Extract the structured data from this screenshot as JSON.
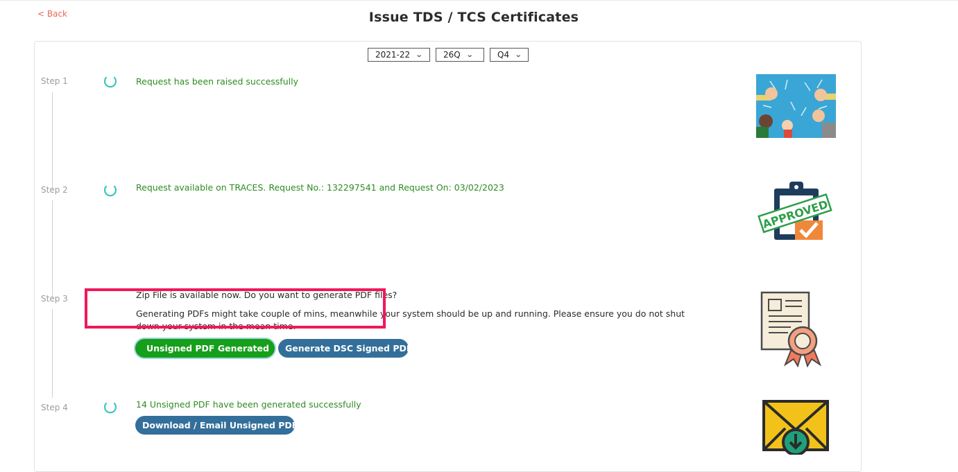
{
  "nav": {
    "back_label": "< Back"
  },
  "page": {
    "title": "Issue TDS / TCS Certificates"
  },
  "filters": {
    "financial_year": "2021-22",
    "form": "26Q",
    "quarter": "Q4"
  },
  "steps": [
    {
      "label": "Step 1",
      "message": "Request has been raised successfully",
      "icon": "thumbs-up-illustration-icon"
    },
    {
      "label": "Step 2",
      "message": "Request available on TRACES. Request No.: 132297541 and Request On: 03/02/2023",
      "icon": "approved-clipboard-icon",
      "stamp_text": "APPROVED"
    },
    {
      "label": "Step 3",
      "question": "Zip File is available now. Do you want to generate PDF files?",
      "note_line1": "Generating PDFs might take couple of mins, meanwhile your system should be up and running. Please ensure you do not shut",
      "note_line2": "down your system in the mean time.",
      "primary_button": "Unsigned PDF Generated",
      "secondary_button": "Generate DSC Signed PDF",
      "icon": "certificate-icon"
    },
    {
      "label": "Step 4",
      "message": "14 Unsigned PDF have been generated successfully",
      "button": "Download / Email Unsigned PDF",
      "icon": "envelope-download-icon"
    }
  ],
  "colors": {
    "success_text": "#2e8b22",
    "button_blue": "#336f9a",
    "button_green": "#169f1a",
    "highlight": "#f0185a",
    "back_link": "#e8675c"
  }
}
